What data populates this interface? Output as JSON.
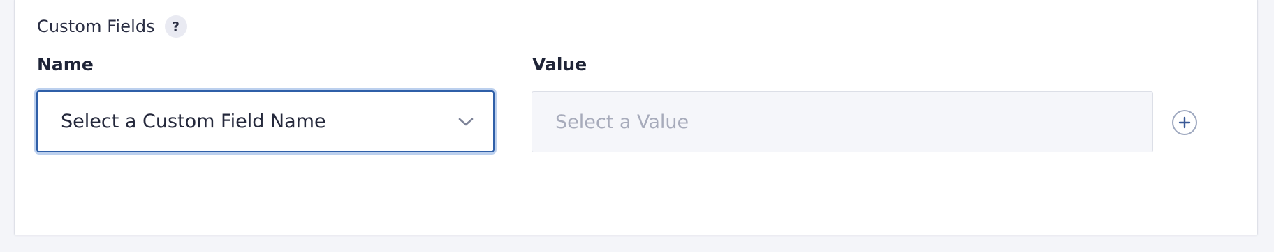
{
  "section": {
    "title": "Custom Fields",
    "help_icon": "question-mark-icon",
    "help_label": "?"
  },
  "columns": {
    "name_label": "Name",
    "value_label": "Value"
  },
  "name_select": {
    "selected": "Select a Custom Field Name",
    "icon": "chevron-down-icon"
  },
  "value_input": {
    "value": "",
    "placeholder": "Select a Value"
  },
  "add_button": {
    "icon": "plus-circle-icon"
  },
  "colors": {
    "focus_border": "#2f5fa8",
    "focus_ring": "#bcd0ee",
    "text": "#24283b",
    "placeholder": "#a7abbb",
    "disabled_bg": "#f5f6fa",
    "icon_blue": "#3a5a97"
  }
}
